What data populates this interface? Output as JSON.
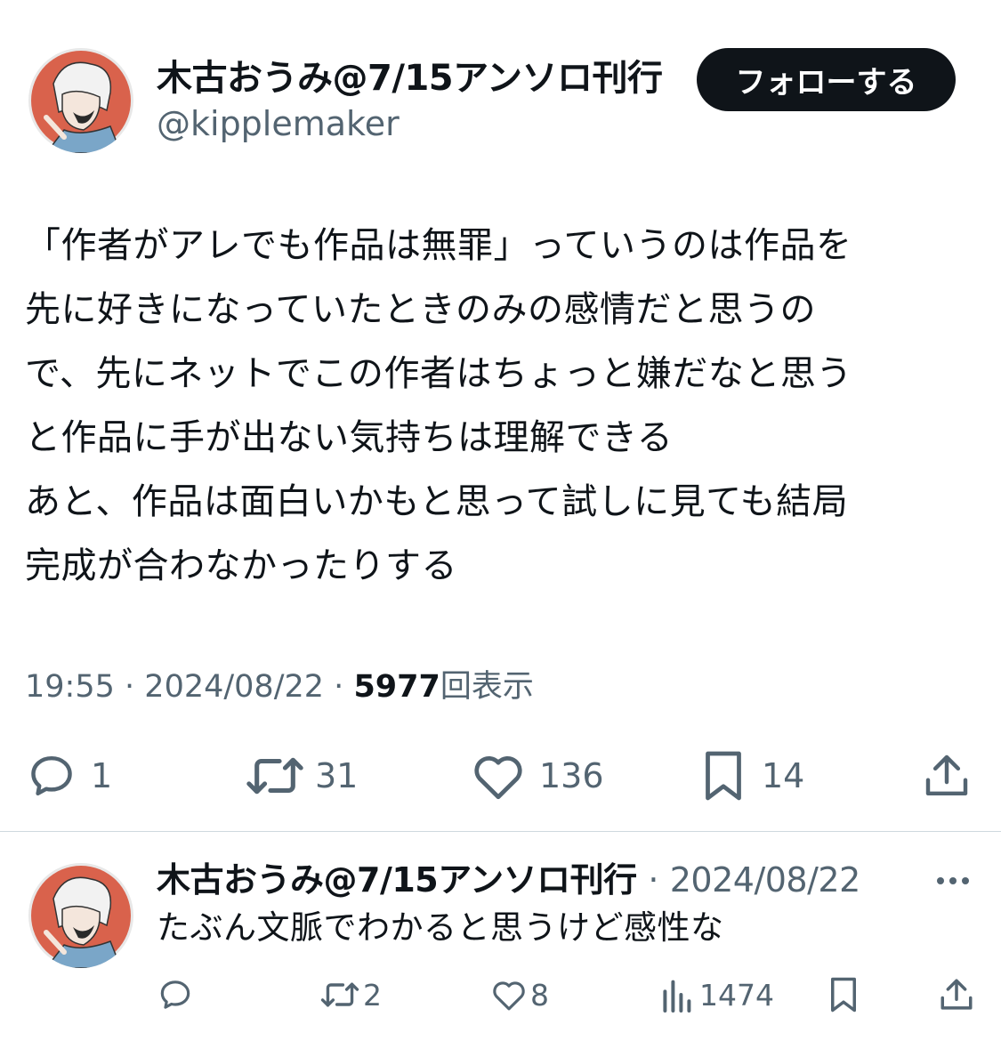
{
  "tweet": {
    "author_name": "木古おうみ@7/15アンソロ刊行",
    "author_handle": "@kipplemaker",
    "follow_label": "フォローする",
    "lines": [
      "「作者がアレでも作品は無罪」っていうのは作品を",
      "先に好きになっていたときのみの感情だと思うの",
      "で、先にネットでこの作者はちょっと嫌だなと思う",
      "と作品に手が出ない気持ちは理解できる",
      "あと、作品は面白いかもと思って試しに見ても結局",
      "完成が合わなかったりする"
    ],
    "time": "19:55",
    "date": "2024/08/22",
    "views_count": "5977",
    "views_label": "回表示",
    "separator": "·",
    "actions": {
      "reply_count": "1",
      "retweet_count": "31",
      "like_count": "136",
      "bookmark_count": "14"
    }
  },
  "reply": {
    "author_name": "木古おうみ@7/15アンソロ刊行",
    "date": "2024/08/22",
    "separator": "·",
    "text": "たぶん文脈でわかると思うけど感性な",
    "actions": {
      "retweet_count": "2",
      "like_count": "8",
      "views_count": "1474"
    }
  },
  "colors": {
    "text": "#0f1419",
    "secondary": "#536471",
    "follow_bg": "#0f1419",
    "divider": "#cfd9de",
    "avatar_bg": "#d9624c"
  },
  "icons": [
    "reply-icon",
    "retweet-icon",
    "like-icon",
    "bookmark-icon",
    "share-icon",
    "more-icon",
    "views-icon"
  ]
}
